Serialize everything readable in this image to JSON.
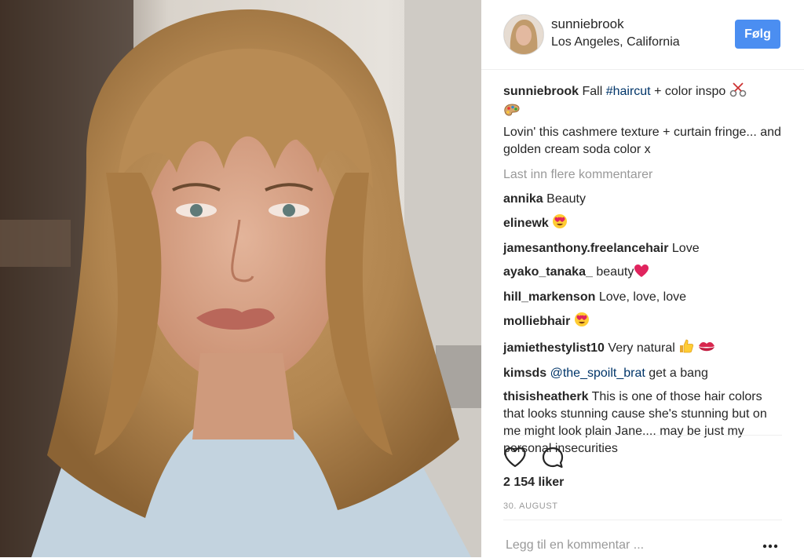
{
  "post": {
    "username": "sunniebrook",
    "location": "Los Angeles, California",
    "follow_label": "Følg"
  },
  "caption": {
    "username": "sunniebrook",
    "text_before": "Fall ",
    "hashtag": "#haircut",
    "text_after": " + color inspo",
    "line2": "Lovin' this cashmere texture + curtain fringe... and golden cream soda color x",
    "icons": [
      "scissors-icon",
      "palette-icon"
    ]
  },
  "load_more": "Last inn flere kommentarer",
  "comments": [
    {
      "user": "annika",
      "text": "Beauty"
    },
    {
      "user": "elinewk",
      "text": "",
      "icon": "heart-eyes-icon"
    },
    {
      "user": "jamesanthony.freelancehair",
      "text": "Love"
    },
    {
      "user": "ayako_tanaka_",
      "text": "beauty",
      "icon": "red-heart-icon"
    },
    {
      "user": "hill_markenson",
      "text": "Love, love, love"
    },
    {
      "user": "molliebhair",
      "text": "",
      "icon": "heart-eyes-icon"
    },
    {
      "user": "jamiethestylist10",
      "text": "Very natural",
      "icons": [
        "thumbs-up-icon",
        "kiss-lips-icon"
      ]
    },
    {
      "user": "kimsds",
      "mention": "@the_spoilt_brat",
      "text": " get a bang"
    },
    {
      "user": "thisisheatherk",
      "text": "This is one of those hair colors that looks stunning cause she's stunning but on me might look plain Jane.... may be just my personal insecurities"
    }
  ],
  "likes": "2 154 liker",
  "date": "30. AUGUST",
  "comment_input": {
    "placeholder": "Legg til en kommentar ..."
  },
  "colors": {
    "follow_button": "#4b8ef1",
    "hashtag": "#003569",
    "muted": "#999999"
  }
}
